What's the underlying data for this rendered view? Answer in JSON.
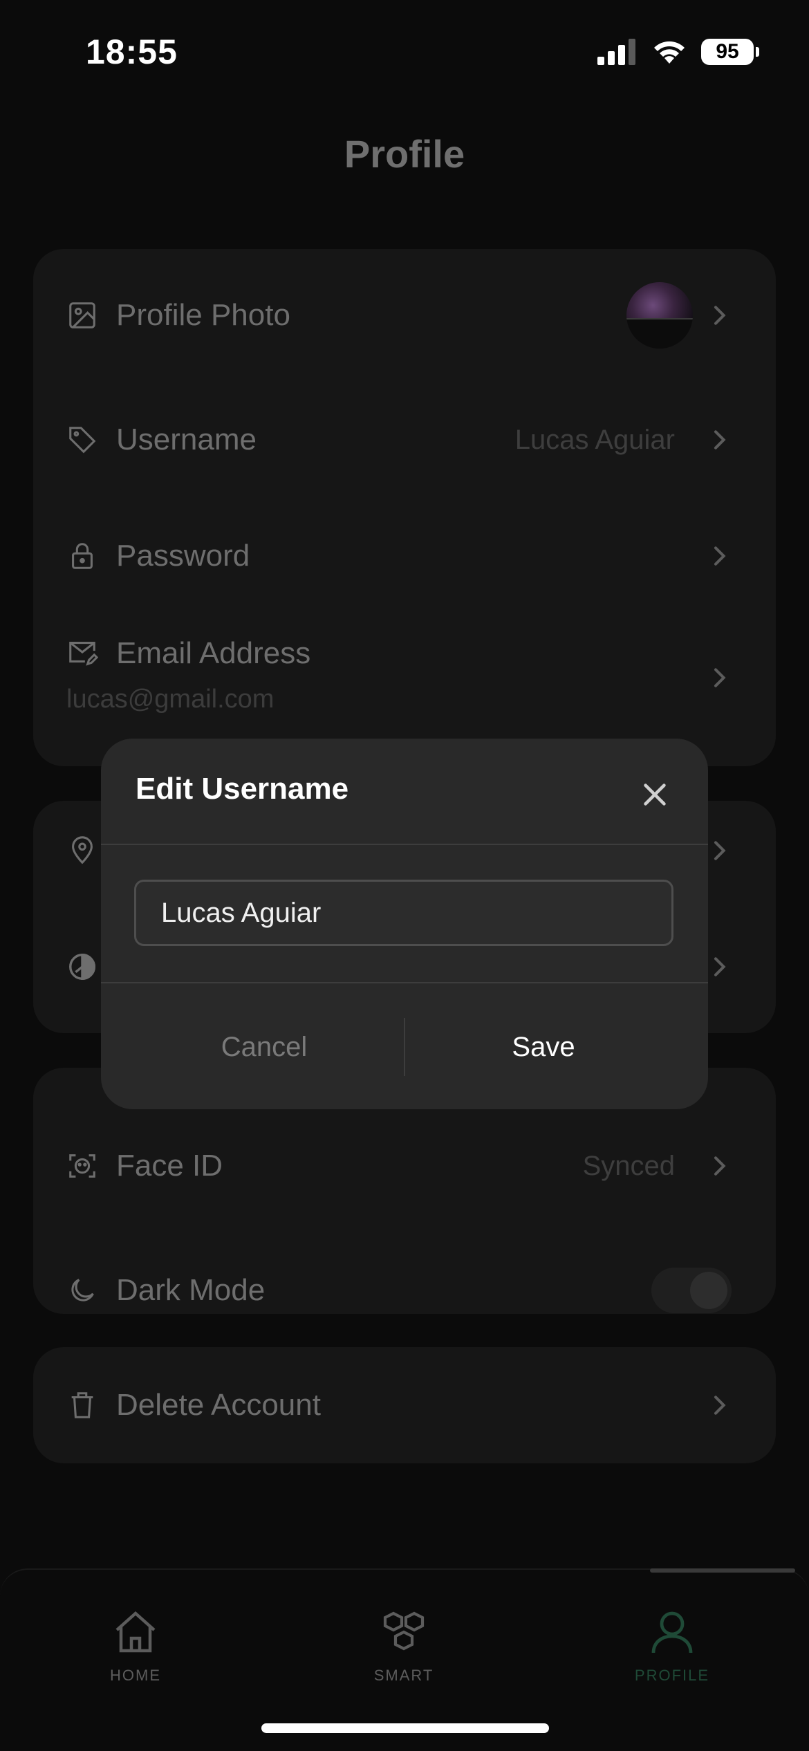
{
  "status_bar": {
    "time": "18:55",
    "battery": "95"
  },
  "header": {
    "title": "Profile"
  },
  "account_card": {
    "profile_photo_label": "Profile Photo",
    "username_label": "Username",
    "username_value": "Lucas Aguiar",
    "password_label": "Password",
    "email_label": "Email Address",
    "email_value": "lucas@gmail.com"
  },
  "security_card": {
    "face_id_label": "Face ID",
    "face_id_value": "Synced",
    "dark_mode_label": "Dark Mode",
    "dark_mode_on": false
  },
  "danger_card": {
    "delete_label": "Delete Account"
  },
  "tabs": [
    {
      "label": "HOME",
      "icon": "home-icon",
      "active": false
    },
    {
      "label": "SMART",
      "icon": "cubes-icon",
      "active": false
    },
    {
      "label": "PROFILE",
      "icon": "person-icon",
      "active": true
    }
  ],
  "modal": {
    "title": "Edit Username",
    "input_value": "Lucas Aguiar",
    "cancel_label": "Cancel",
    "save_label": "Save"
  },
  "colors": {
    "accent": "#1f4a37",
    "background": "#0b0b0b",
    "modal": "#292929"
  }
}
